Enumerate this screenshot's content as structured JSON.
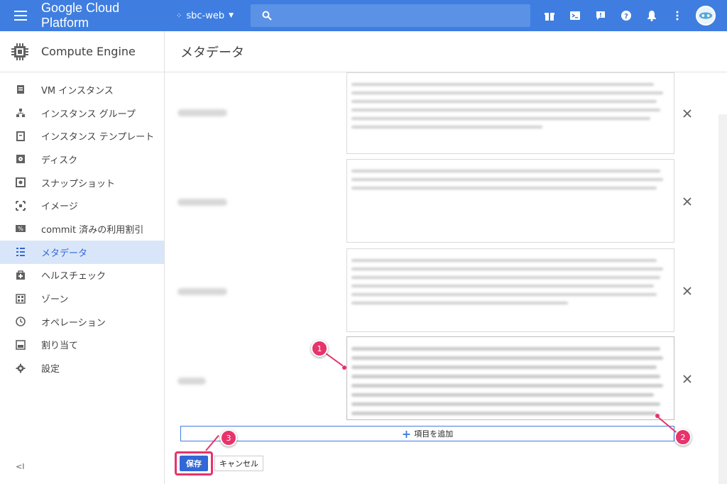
{
  "topbar": {
    "product_name": "Google Cloud Platform",
    "project_name": "sbc-web",
    "bg_color": "#3f7ee0"
  },
  "sidebar": {
    "title": "Compute Engine",
    "items": [
      {
        "label": "VM インスタンス",
        "icon": "vm-icon"
      },
      {
        "label": "インスタンス グループ",
        "icon": "instance-group-icon"
      },
      {
        "label": "インスタンス テンプレート",
        "icon": "template-icon"
      },
      {
        "label": "ディスク",
        "icon": "disk-icon"
      },
      {
        "label": "スナップショット",
        "icon": "snapshot-icon"
      },
      {
        "label": "イメージ",
        "icon": "image-icon"
      },
      {
        "label": "commit 済みの利用割引",
        "icon": "percent-icon"
      },
      {
        "label": "メタデータ",
        "icon": "metadata-icon",
        "active": true
      },
      {
        "label": "ヘルスチェック",
        "icon": "health-check-icon"
      },
      {
        "label": "ゾーン",
        "icon": "zone-icon"
      },
      {
        "label": "オペレーション",
        "icon": "clock-icon"
      },
      {
        "label": "割り当て",
        "icon": "quota-icon"
      },
      {
        "label": "設定",
        "icon": "gear-icon"
      }
    ],
    "collapse_label": "<I"
  },
  "main": {
    "page_title": "メタデータ",
    "add_item_label": "項目を追加",
    "save_label": "保存",
    "cancel_label": "キャンセル"
  },
  "callouts": [
    "1",
    "2",
    "3"
  ],
  "accent_color": "#e8336b"
}
